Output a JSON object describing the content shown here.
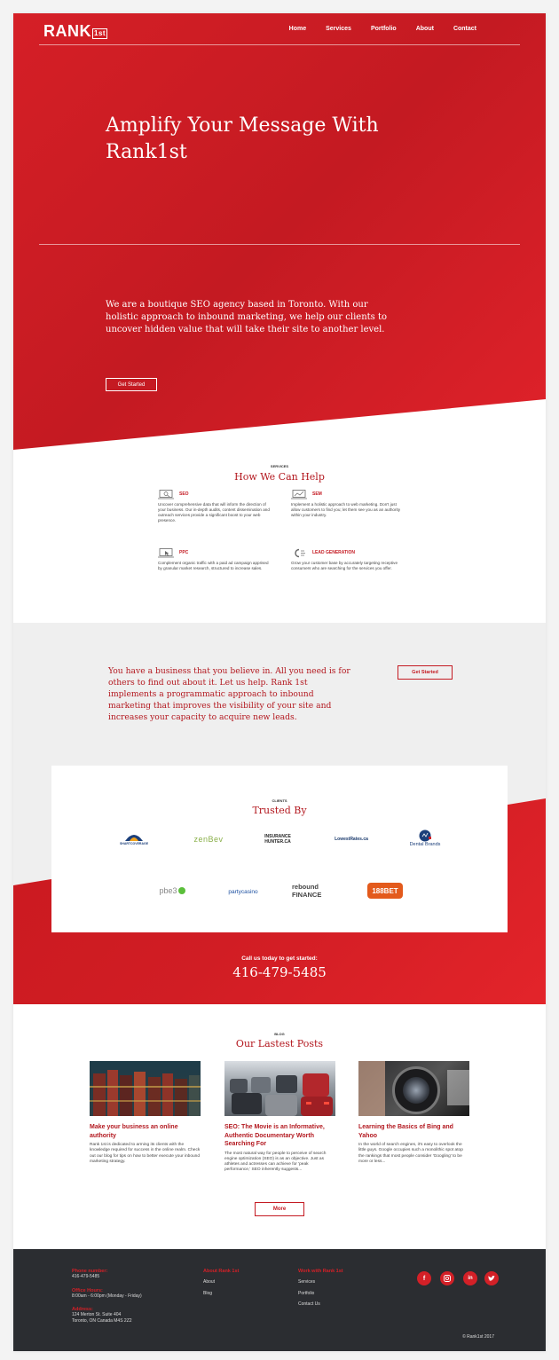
{
  "brand": {
    "logo_main": "RANK",
    "logo_sup": "1st"
  },
  "nav": [
    "Home",
    "Services",
    "Portfolio",
    "About",
    "Contact"
  ],
  "hero": {
    "title": "Amplify Your Message With Rank1st",
    "text": "We are a boutique SEO agency based in Toronto. With our holistic approach to inbound marketing, we help our clients to uncover hidden value  that will take their site to another level.",
    "button": "Get Started"
  },
  "services": {
    "kicker": "SERVICES",
    "title": "How We Can Help",
    "items": [
      {
        "name": "SEO",
        "icon": "laptop-search-icon",
        "desc": "Uncover comprehensive data that will inform the direction of your business. Our in-depth audits, content dissemination and outreach services provide a significant boost to your web presence."
      },
      {
        "name": "SEM",
        "icon": "laptop-chart-icon",
        "desc": "Implement a holistic approach to web marketing. Don't just allow customers to find you; let them see you as an authority within your industry."
      },
      {
        "name": "PPC",
        "icon": "laptop-click-icon",
        "desc": "Complement organic traffic with a paid ad campaign apprised by granular market research, structured to increase sales."
      },
      {
        "name": "LEAD GENERATION",
        "icon": "magnet-icon",
        "desc": "Grow your customer base by accurately targeting receptive consumers who are searching for the services you offer."
      }
    ]
  },
  "cta": {
    "text": "You have a business that you believe in. All you need is for others to find out about it. Let us help. Rank 1st implements a programmatic approach to inbound marketing that improves the visibility of your site and increases your capacity to acquire new leads.",
    "button": "Get Started"
  },
  "clients": {
    "kicker": "CLIENTS",
    "title": "Trusted By",
    "logos": [
      "SHARTCOVERAGE",
      "zenBev",
      "INSURANCE HUNTER.CA",
      "LowestRates.ca",
      "Dental Brands",
      "pbe3",
      "partycasino",
      "rebound FINANCE",
      "188BET"
    ]
  },
  "call": {
    "label": "Call us today to get started:",
    "phone": "416-479-5485"
  },
  "blog": {
    "kicker": "BLOG",
    "title": "Our Lastest Posts",
    "posts": [
      {
        "title": "Make your business an online authority",
        "text": "Rank 1st is dedicated to arming its clients with the knowledge required for success in the online realm. Check out our blog for tips on how to better execute your inbound marketing strategy."
      },
      {
        "title": "SEO: The Movie is an Informative, Authentic Documentary Worth Searching For",
        "text": "The most natural way for people to perceive of search engine optimization (SEO) is as an objective. Just as athletes and actresses can achieve for 'peak performance,' SEO inherently suggests..."
      },
      {
        "title": "Learning the Basics of Bing and Yahoo",
        "text": "In the world of search engines, it's easy to overlook the little guys. Google occupies such a monolithic spot atop the rankings that most people consider 'Googling' to be more or less..."
      }
    ],
    "more": "More"
  },
  "footer": {
    "phone_label": "Phone number:",
    "phone": "416-479-5485",
    "hours_label": "Office Hours:",
    "hours": "8:00am - 6:00pm (Monday - Friday)",
    "address_label": "Address:",
    "address_line1": "124 Merton St. Suite 404",
    "address_line2": "Toronto, ON Canada M4S 2Z2",
    "about_label": "About Rank 1st",
    "about_links": [
      "About",
      "Blog"
    ],
    "work_label": "Work with Rank 1st",
    "work_links": [
      "Services",
      "Portfolio",
      "Contact Us"
    ],
    "social": [
      "facebook-icon",
      "instagram-icon",
      "linkedin-icon",
      "twitter-icon"
    ],
    "copyright": "© Rank1st 2017"
  },
  "colors": {
    "brand_red": "#d32027",
    "dark_red": "#b3181f",
    "footer_bg": "#2b2d31",
    "gray_bg": "#efefef"
  }
}
